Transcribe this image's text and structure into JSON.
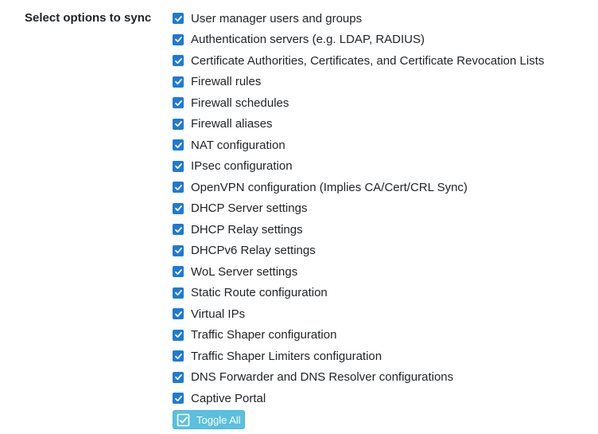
{
  "section": {
    "label": "Select options to sync"
  },
  "options": [
    {
      "label": "User manager users and groups",
      "checked": true
    },
    {
      "label": "Authentication servers (e.g. LDAP, RADIUS)",
      "checked": true
    },
    {
      "label": "Certificate Authorities, Certificates, and Certificate Revocation Lists",
      "checked": true
    },
    {
      "label": "Firewall rules",
      "checked": true
    },
    {
      "label": "Firewall schedules",
      "checked": true
    },
    {
      "label": "Firewall aliases",
      "checked": true
    },
    {
      "label": "NAT configuration",
      "checked": true
    },
    {
      "label": "IPsec configuration",
      "checked": true
    },
    {
      "label": "OpenVPN configuration (Implies CA/Cert/CRL Sync)",
      "checked": true
    },
    {
      "label": "DHCP Server settings",
      "checked": true
    },
    {
      "label": "DHCP Relay settings",
      "checked": true
    },
    {
      "label": "DHCPv6 Relay settings",
      "checked": true
    },
    {
      "label": "WoL Server settings",
      "checked": true
    },
    {
      "label": "Static Route configuration",
      "checked": true
    },
    {
      "label": "Virtual IPs",
      "checked": true
    },
    {
      "label": "Traffic Shaper configuration",
      "checked": true
    },
    {
      "label": "Traffic Shaper Limiters configuration",
      "checked": true
    },
    {
      "label": "DNS Forwarder and DNS Resolver configurations",
      "checked": true
    },
    {
      "label": "Captive Portal",
      "checked": true
    }
  ],
  "toggle_all": {
    "label": "Toggle All",
    "icon": "checkbox-checked-icon"
  },
  "colors": {
    "checkbox": "#1e7ad4",
    "button": "#5bc0de",
    "text": "#212529"
  }
}
